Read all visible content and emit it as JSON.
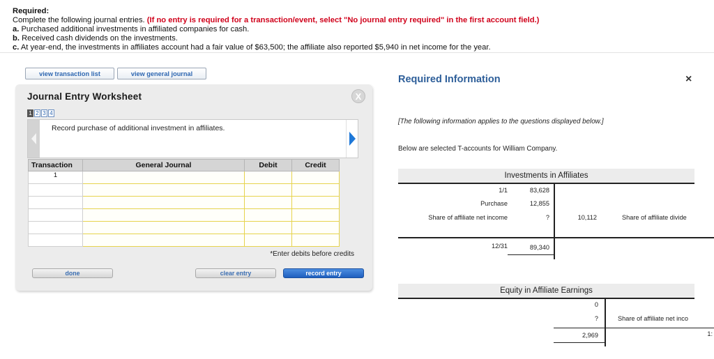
{
  "instructions": {
    "required_label": "Required:",
    "intro": "Complete the following journal entries.",
    "hint": "(If no entry is required for a transaction/event, select \"No journal entry required\" in the first account field.)",
    "items": [
      {
        "letter": "a.",
        "text": "Purchased additional investments in affiliated companies for cash."
      },
      {
        "letter": "b.",
        "text": "Received cash dividends on the investments."
      },
      {
        "letter": "c.",
        "text": "At year-end, the investments in affiliates account had a fair value of $63,500; the affiliate also reported $5,940 in net income for the year."
      }
    ]
  },
  "top_buttons": {
    "transaction_list": "view transaction list",
    "general_journal": "view general journal"
  },
  "worksheet": {
    "title": "Journal Entry Worksheet",
    "close_glyph": "X",
    "pages": [
      "1",
      "2",
      "3",
      "4"
    ],
    "active_page": "1",
    "record_text": "Record purchase of additional investment in affiliates.",
    "columns": {
      "transaction": "Transaction",
      "account": "General Journal",
      "debit": "Debit",
      "credit": "Credit"
    },
    "rows": [
      {
        "transaction": "1",
        "account": "",
        "debit": "",
        "credit": ""
      },
      {
        "transaction": "",
        "account": "",
        "debit": "",
        "credit": ""
      },
      {
        "transaction": "",
        "account": "",
        "debit": "",
        "credit": ""
      },
      {
        "transaction": "",
        "account": "",
        "debit": "",
        "credit": ""
      },
      {
        "transaction": "",
        "account": "",
        "debit": "",
        "credit": ""
      },
      {
        "transaction": "",
        "account": "",
        "debit": "",
        "credit": ""
      }
    ],
    "note": "*Enter debits before credits",
    "buttons": {
      "done": "done",
      "clear": "clear entry",
      "record": "record entry"
    }
  },
  "required_info": {
    "title": "Required Information",
    "close_glyph": "×",
    "applies_note": "[The following information applies to the questions displayed below.]",
    "below_text": "Below are selected T-accounts for William Company.",
    "t_accounts": {
      "investments": {
        "title": "Investments in Affiliates",
        "debits": [
          {
            "label": "1/1",
            "value": "83,628"
          },
          {
            "label": "Purchase",
            "value": "12,855"
          },
          {
            "label": "Share of affiliate net income",
            "value": "?"
          }
        ],
        "credit": {
          "value": "10,112",
          "label": "Share of affiliate divide"
        },
        "balance": {
          "label": "12/31",
          "value": "89,340"
        }
      },
      "equity": {
        "title": "Equity in Affiliate Earnings",
        "credits": [
          {
            "value": "0",
            "label": ""
          },
          {
            "value": "?",
            "label": "Share of affiliate net inco"
          }
        ],
        "debit_total": "2,969",
        "right_partial": "1:"
      }
    }
  }
}
